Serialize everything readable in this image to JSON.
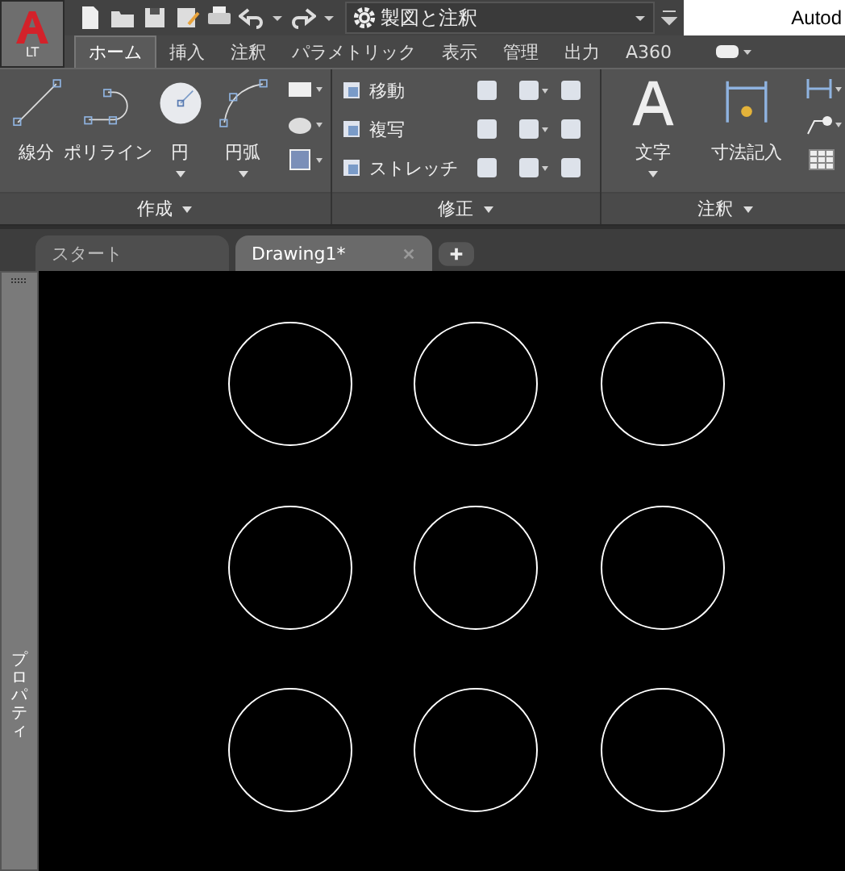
{
  "app_button": {
    "label": "LT"
  },
  "workspace": {
    "title": "製図と注釈"
  },
  "window": {
    "title": "Autod"
  },
  "ribbon_tabs": [
    {
      "label": "ホーム",
      "selected": true
    },
    {
      "label": "挿入",
      "selected": false
    },
    {
      "label": "注釈",
      "selected": false
    },
    {
      "label": "パラメトリック",
      "selected": false
    },
    {
      "label": "表示",
      "selected": false
    },
    {
      "label": "管理",
      "selected": false
    },
    {
      "label": "出力",
      "selected": false
    },
    {
      "label": "A360",
      "selected": false
    }
  ],
  "panels": {
    "draw": {
      "title": "作成",
      "tools": [
        "線分",
        "ポリライン",
        "円",
        "円弧"
      ]
    },
    "modify": {
      "title": "修正",
      "tools": [
        "移動",
        "複写",
        "ストレッチ"
      ]
    },
    "annotation": {
      "title": "注釈",
      "tools": [
        "文字",
        "寸法記入"
      ]
    }
  },
  "file_tabs": [
    {
      "label": "スタート",
      "selected": false
    },
    {
      "label": "Drawing1*",
      "selected": true
    }
  ],
  "side_palette": {
    "title": "プロパティ"
  }
}
